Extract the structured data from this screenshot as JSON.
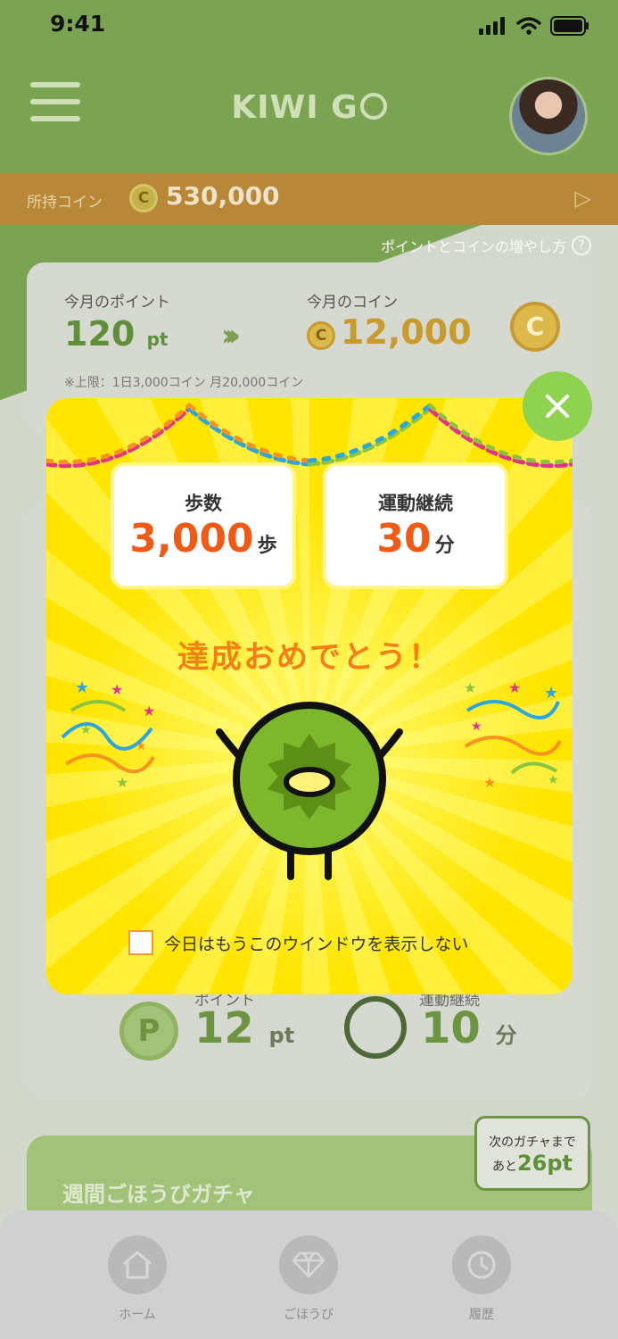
{
  "status_bar": {
    "time": "9:41"
  },
  "header": {
    "logo_text": "KIWI G",
    "menu_icon": "hamburger-menu-icon",
    "avatar_icon": "user-avatar"
  },
  "coin_bar": {
    "label": "所持コイン",
    "coin_symbol": "C",
    "value": "530,000"
  },
  "help_link": {
    "text": "ポイントとコインの増やし方",
    "icon": "?"
  },
  "monthly": {
    "points_label": "今月のポイント",
    "points_value": "120",
    "points_unit": "pt",
    "coins_label": "今月のコイン",
    "coins_value": "12,000",
    "coin_symbol": "C",
    "note": "※上限：1日3,000コイン 月20,000コイン"
  },
  "activity": {
    "points_label": "ポイント",
    "points_value": "12",
    "points_unit": "pt",
    "points_icon_letter": "P",
    "exercise_label": "運動継続",
    "exercise_value": "10",
    "exercise_unit": "分"
  },
  "gacha": {
    "title": "週間ごほうびガチャ",
    "bubble_line1": "次のガチャまで",
    "bubble_prefix": "あと",
    "bubble_value": "26pt"
  },
  "tabs": [
    {
      "label": "ホーム",
      "icon": "home-icon"
    },
    {
      "label": "ごほうび",
      "icon": "diamond-icon"
    },
    {
      "label": "履歴",
      "icon": "history-icon"
    }
  ],
  "modal": {
    "steps": {
      "title": "歩数",
      "value": "3,000",
      "unit": "歩"
    },
    "exercise": {
      "title": "運動継続",
      "value": "30",
      "unit": "分"
    },
    "congrats": "達成おめでとう！",
    "dont_show_label": "今日はもうこのウインドウを表示しない",
    "dont_show_checked": false
  },
  "colors": {
    "header_green": "#7aa352",
    "modal_yellow": "#ffe500",
    "accent_orange": "#f05a17",
    "close_green": "#8fd250"
  }
}
